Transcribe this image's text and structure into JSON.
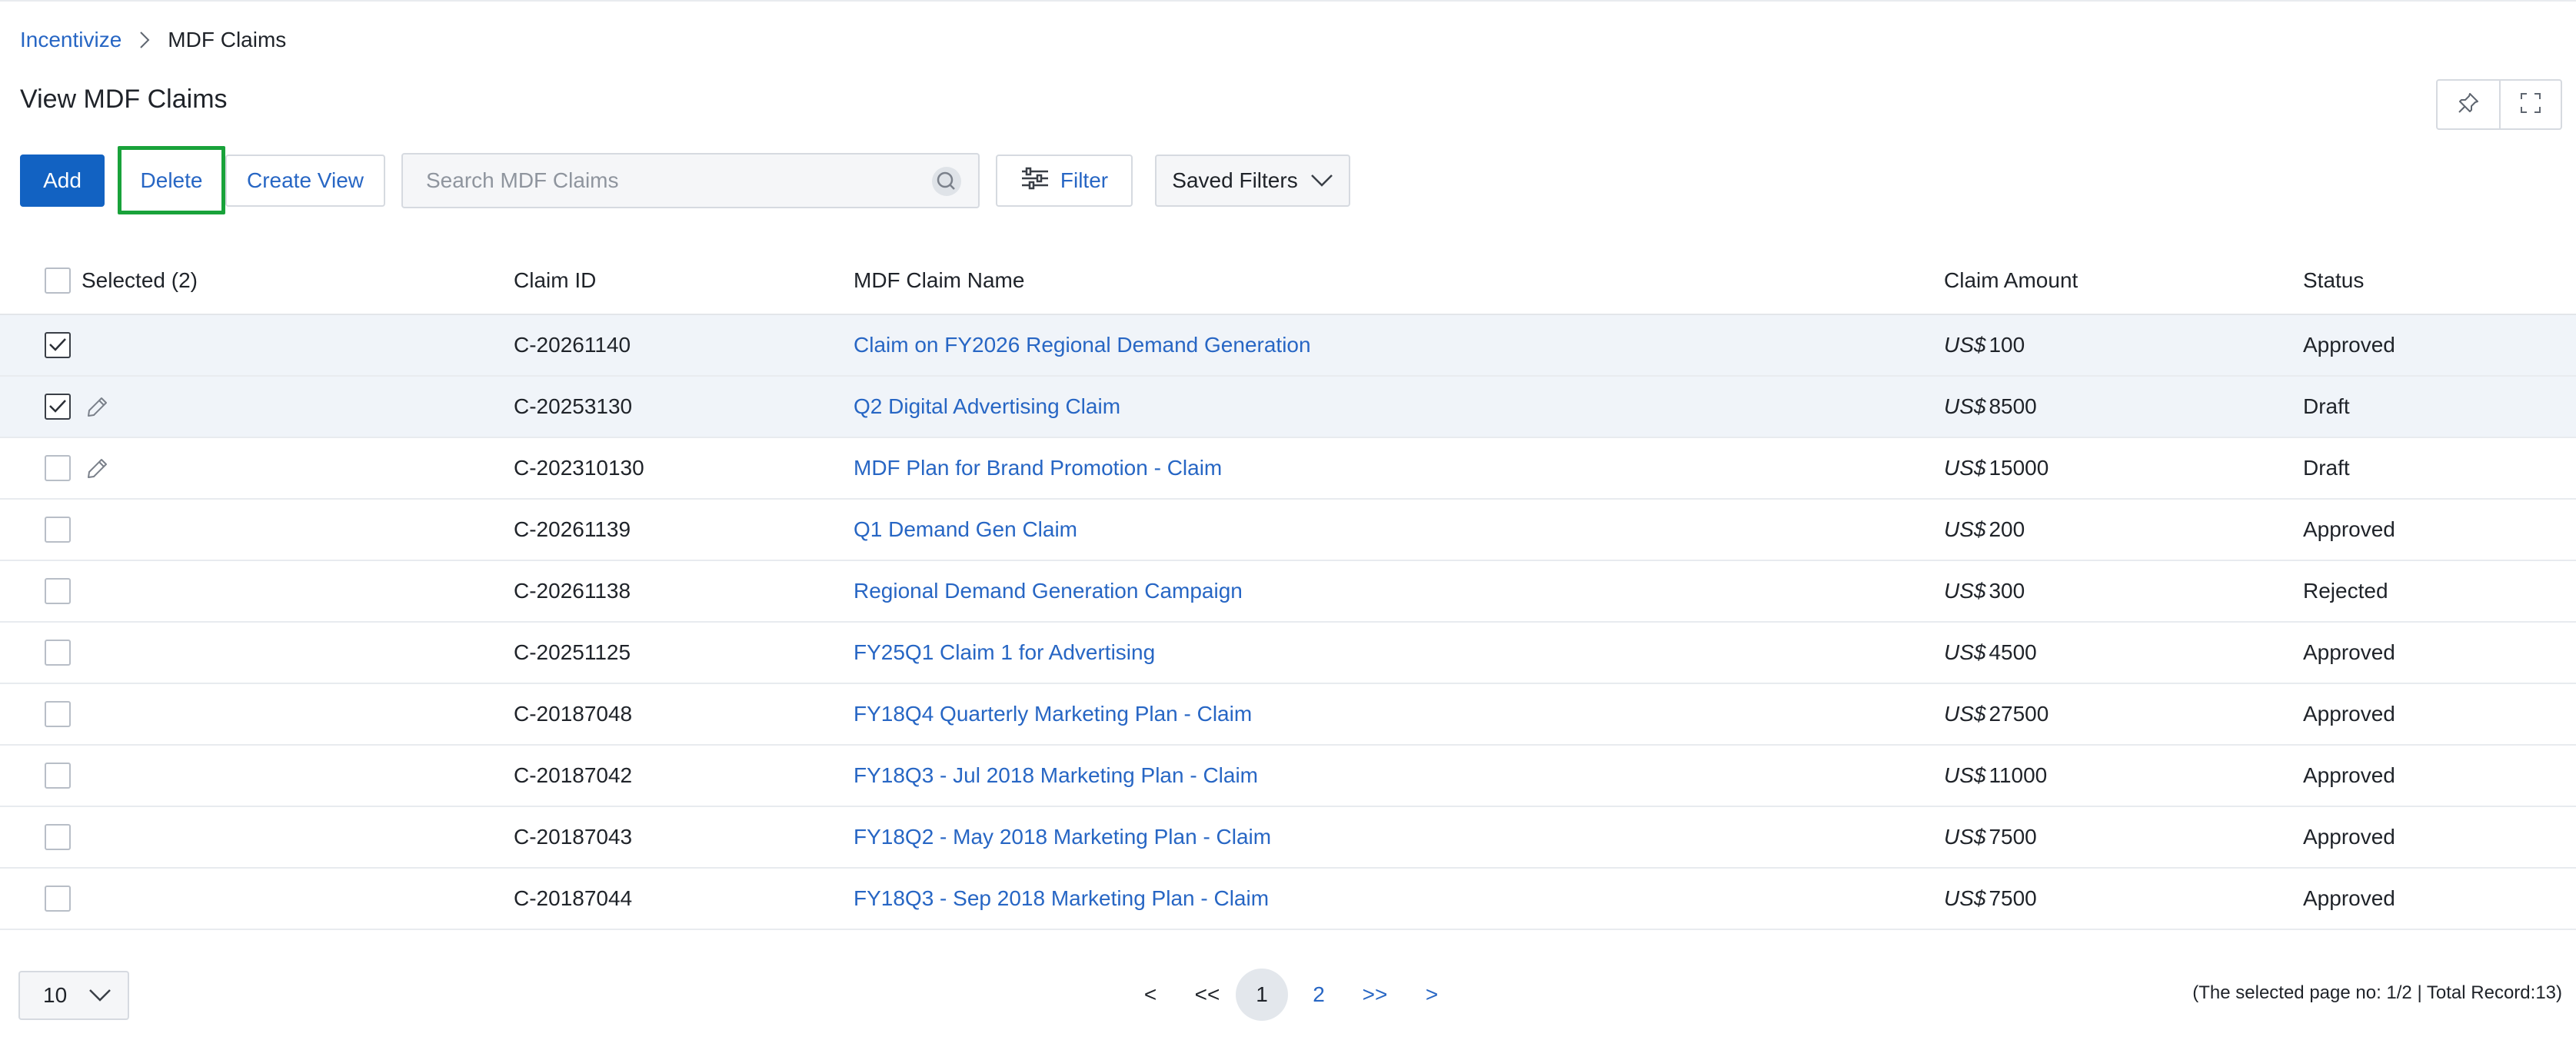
{
  "breadcrumb": {
    "parent": "Incentivize",
    "current": "MDF Claims"
  },
  "page_title": "View MDF Claims",
  "toolbar": {
    "add_label": "Add",
    "delete_label": "Delete",
    "create_view_label": "Create View",
    "search_placeholder": "Search MDF Claims",
    "search_value": "",
    "filter_label": "Filter",
    "saved_filters_label": "Saved Filters"
  },
  "table": {
    "columns": {
      "selected": "Selected (2)",
      "claim_id": "Claim ID",
      "name": "MDF Claim Name",
      "amount": "Claim Amount",
      "status": "Status"
    },
    "rows": [
      {
        "checked": true,
        "editable": false,
        "claim_id": "C-20261140",
        "name": "Claim on FY2026 Regional Demand Generation",
        "currency": "US$",
        "amount": "100",
        "status": "Approved"
      },
      {
        "checked": true,
        "editable": true,
        "claim_id": "C-20253130",
        "name": "Q2 Digital Advertising Claim",
        "currency": "US$",
        "amount": "8500",
        "status": "Draft"
      },
      {
        "checked": false,
        "editable": true,
        "claim_id": "C-202310130",
        "name": "MDF Plan for Brand Promotion - Claim",
        "currency": "US$",
        "amount": "15000",
        "status": "Draft"
      },
      {
        "checked": false,
        "editable": false,
        "claim_id": "C-20261139",
        "name": "Q1 Demand Gen Claim",
        "currency": "US$",
        "amount": "200",
        "status": "Approved"
      },
      {
        "checked": false,
        "editable": false,
        "claim_id": "C-20261138",
        "name": "Regional Demand Generation Campaign",
        "currency": "US$",
        "amount": "300",
        "status": "Rejected"
      },
      {
        "checked": false,
        "editable": false,
        "claim_id": "C-20251125",
        "name": "FY25Q1 Claim 1 for Advertising",
        "currency": "US$",
        "amount": "4500",
        "status": "Approved"
      },
      {
        "checked": false,
        "editable": false,
        "claim_id": "C-20187048",
        "name": "FY18Q4 Quarterly Marketing Plan - Claim",
        "currency": "US$",
        "amount": "27500",
        "status": "Approved"
      },
      {
        "checked": false,
        "editable": false,
        "claim_id": "C-20187042",
        "name": "FY18Q3 - Jul 2018 Marketing Plan - Claim",
        "currency": "US$",
        "amount": "11000",
        "status": "Approved"
      },
      {
        "checked": false,
        "editable": false,
        "claim_id": "C-20187043",
        "name": "FY18Q2 - May 2018 Marketing Plan - Claim",
        "currency": "US$",
        "amount": "7500",
        "status": "Approved"
      },
      {
        "checked": false,
        "editable": false,
        "claim_id": "C-20187044",
        "name": "FY18Q3 - Sep 2018 Marketing Plan - Claim",
        "currency": "US$",
        "amount": "7500",
        "status": "Approved"
      }
    ]
  },
  "pagination": {
    "page_size": "10",
    "prev": "<",
    "first": "<<",
    "pages": [
      "1",
      "2"
    ],
    "current_page": "1",
    "last": ">>",
    "next": ">",
    "info": "(The selected page no: 1/2 | Total Record:13)"
  },
  "icons": {
    "breadcrumb_separator": "chevron-right-icon",
    "pin": "pin-icon",
    "fullscreen": "fullscreen-icon",
    "search": "search-icon",
    "filter": "sliders-icon",
    "dropdown": "chevron-down-icon",
    "edit": "pencil-icon",
    "check": "checkmark-icon"
  },
  "colors": {
    "primary": "#1262c2",
    "link": "#2766c4",
    "highlight_border": "#19a23a",
    "selected_row": "#f0f4f9"
  }
}
